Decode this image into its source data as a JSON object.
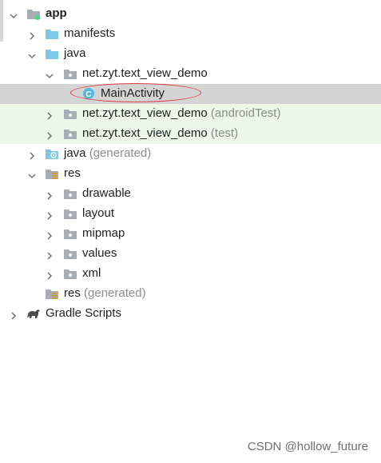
{
  "tree": [
    {
      "name": "node-app",
      "label": "app",
      "icon": "android-module-icon",
      "bold": true,
      "chevron": "down"
    },
    {
      "name": "node-manifests",
      "label": "manifests",
      "icon": "folder-icon",
      "chevron": "right"
    },
    {
      "name": "node-java",
      "label": "java",
      "icon": "folder-icon",
      "chevron": "down"
    },
    {
      "name": "node-package-main",
      "label": "net.zyt.text_view_demo",
      "icon": "package-icon",
      "chevron": "down"
    },
    {
      "name": "node-main-activity",
      "label": "MainActivity",
      "icon": "class-icon",
      "chevron": "none",
      "selected": true
    },
    {
      "name": "node-package-android-test",
      "label": "net.zyt.text_view_demo",
      "suffix": "(androidTest)",
      "icon": "package-icon",
      "chevron": "right",
      "test": true
    },
    {
      "name": "node-package-test",
      "label": "net.zyt.text_view_demo",
      "suffix": "(test)",
      "icon": "package-icon",
      "chevron": "right",
      "test": true
    },
    {
      "name": "node-java-generated",
      "label": "java",
      "suffix": "(generated)",
      "icon": "generated-folder-icon",
      "chevron": "right"
    },
    {
      "name": "node-res",
      "label": "res",
      "icon": "resource-folder-icon",
      "chevron": "down"
    },
    {
      "name": "node-drawable",
      "label": "drawable",
      "icon": "package-icon",
      "chevron": "right"
    },
    {
      "name": "node-layout",
      "label": "layout",
      "icon": "package-icon",
      "chevron": "right"
    },
    {
      "name": "node-mipmap",
      "label": "mipmap",
      "icon": "package-icon",
      "chevron": "right"
    },
    {
      "name": "node-values",
      "label": "values",
      "icon": "package-icon",
      "chevron": "right"
    },
    {
      "name": "node-xml",
      "label": "xml",
      "icon": "package-icon",
      "chevron": "right"
    },
    {
      "name": "node-res-generated",
      "label": "res",
      "suffix": "(generated)",
      "icon": "resource-folder-icon",
      "chevron": "none"
    },
    {
      "name": "node-gradle-scripts",
      "label": "Gradle Scripts",
      "icon": "gradle-icon",
      "chevron": "right"
    }
  ],
  "watermark": "CSDN @hollow_future",
  "colors": {
    "selection": "#d4d4d4",
    "test_row": "#edf7e7",
    "folder": "#7fc8e8",
    "annotation": "#e03c3c"
  }
}
